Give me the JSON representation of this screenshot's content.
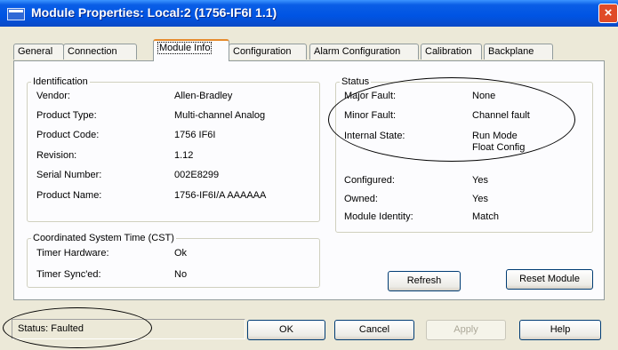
{
  "window": {
    "title": "Module Properties: Local:2 (1756-IF6I 1.1)",
    "close_glyph": "×"
  },
  "tabs": [
    {
      "label": "General"
    },
    {
      "label": "Connection"
    },
    {
      "label": "Module Info"
    },
    {
      "label": "Configuration"
    },
    {
      "label": "Alarm Configuration"
    },
    {
      "label": "Calibration"
    },
    {
      "label": "Backplane"
    }
  ],
  "active_tab": "Module Info",
  "identification": {
    "title": "Identification",
    "rows": [
      {
        "label": "Vendor:",
        "value": "Allen-Bradley"
      },
      {
        "label": "Product Type:",
        "value": "Multi-channel Analog"
      },
      {
        "label": "Product Code:",
        "value": "1756 IF6I"
      },
      {
        "label": "Revision:",
        "value": "1.12"
      },
      {
        "label": "Serial Number:",
        "value": "002E8299"
      },
      {
        "label": "Product Name:",
        "value": "1756-IF6I/A AAAAAA"
      }
    ]
  },
  "cst": {
    "title": "Coordinated System Time (CST)",
    "rows": [
      {
        "label": "Timer Hardware:",
        "value": "Ok"
      },
      {
        "label": "Timer Sync'ed:",
        "value": "No"
      }
    ]
  },
  "status_group": {
    "title": "Status",
    "rows": [
      {
        "label": "Major Fault:",
        "value": "None"
      },
      {
        "label": "Minor Fault:",
        "value": "Channel fault"
      },
      {
        "label": "Internal State:",
        "value": "Run Mode",
        "value2": "Float Config"
      },
      {
        "label": "Configured:",
        "value": "Yes"
      },
      {
        "label": "Owned:",
        "value": "Yes"
      },
      {
        "label": "Module Identity:",
        "value": "Match"
      }
    ]
  },
  "buttons": {
    "refresh": "Refresh",
    "reset_module": "Reset Module",
    "ok": "OK",
    "cancel": "Cancel",
    "apply": "Apply",
    "help": "Help"
  },
  "statusbar": {
    "text": "Status:  Faulted"
  },
  "colors": {
    "titlebar": "#0054e3",
    "dialog_bg": "#ece9d8",
    "close_button": "#e04b28",
    "active_tab_accent": "#e68b2c"
  }
}
